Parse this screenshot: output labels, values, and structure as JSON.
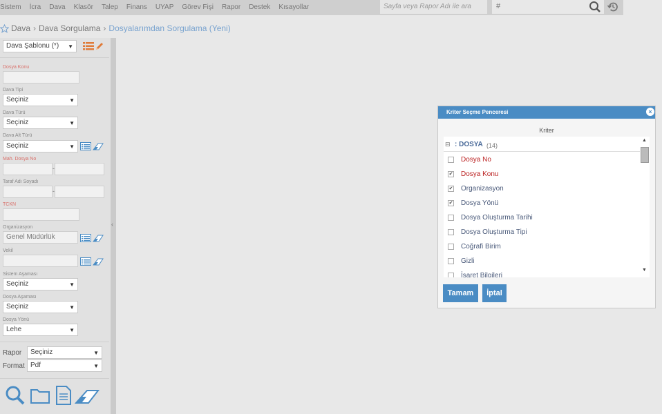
{
  "menu": [
    "Sistem",
    "İcra",
    "Dava",
    "Klasör",
    "Talep",
    "Finans",
    "UYAP",
    "Görev Fişi",
    "Rapor",
    "Destek",
    "Kısayollar"
  ],
  "search": {
    "placeholder": "Sayfa veya Rapor Adı ile ara",
    "hash": "#"
  },
  "breadcrumb": [
    "Dava",
    "Dava Sorgulama",
    "Dosyalarımdan Sorgulama (Yeni)"
  ],
  "form": {
    "template": "Dava Şablonu (*)",
    "dosya_konu_label": "Dosya Konu",
    "dava_tipi_label": "Dava Tipi",
    "dava_tipi": "Seçiniz",
    "dava_turu_label": "Dava Türü",
    "dava_turu": "Seçiniz",
    "dava_alt_turu_label": "Dava Alt Türü",
    "dava_alt_turu": "Seçiniz",
    "mah_dosya_no_label": "Mah. Dosya No",
    "taraf_label": "Taraf Adı Soyadı",
    "tckn_label": "TCKN",
    "organizasyon_label": "Organizasyon",
    "organizasyon": "Genel Müdürlük",
    "vekil_label": "Vekil",
    "sistem_asamasi_label": "Sistem Aşaması",
    "sistem_asamasi": "Seçiniz",
    "dosya_asamasi_label": "Dosya Aşaması",
    "dosya_asamasi": "Seçiniz",
    "dosya_yonu_label": "Dosya Yönü",
    "dosya_yonu": "Lehe",
    "rapor_label": "Rapor",
    "rapor": "Seçiniz",
    "format_label": "Format",
    "format": "Pdf",
    "dash": "-"
  },
  "dialog": {
    "title": "Kriter Seçme Penceresi",
    "close": "×",
    "column_header": "Kriter",
    "group": {
      "toggle": "⊟",
      "name": ": DOSYA",
      "count": "(14)"
    },
    "items": [
      {
        "label": "Dosya No",
        "checked": false,
        "required": true
      },
      {
        "label": "Dosya Konu",
        "checked": true,
        "required": true
      },
      {
        "label": "Organizasyon",
        "checked": true,
        "required": false
      },
      {
        "label": "Dosya Yönü",
        "checked": true,
        "required": false
      },
      {
        "label": "Dosya Oluşturma Tarihi",
        "checked": false,
        "required": false
      },
      {
        "label": "Dosya Oluşturma Tipi",
        "checked": false,
        "required": false
      },
      {
        "label": "Coğrafi Birim",
        "checked": false,
        "required": false
      },
      {
        "label": "Gizli",
        "checked": false,
        "required": false
      },
      {
        "label": "İşaret Bilgileri",
        "checked": false,
        "required": false
      }
    ],
    "ok": "Tamam",
    "cancel": "İptal"
  },
  "colors": {
    "accent": "#4a8cc4",
    "required": "#b22222",
    "orange": "#e07b39"
  }
}
